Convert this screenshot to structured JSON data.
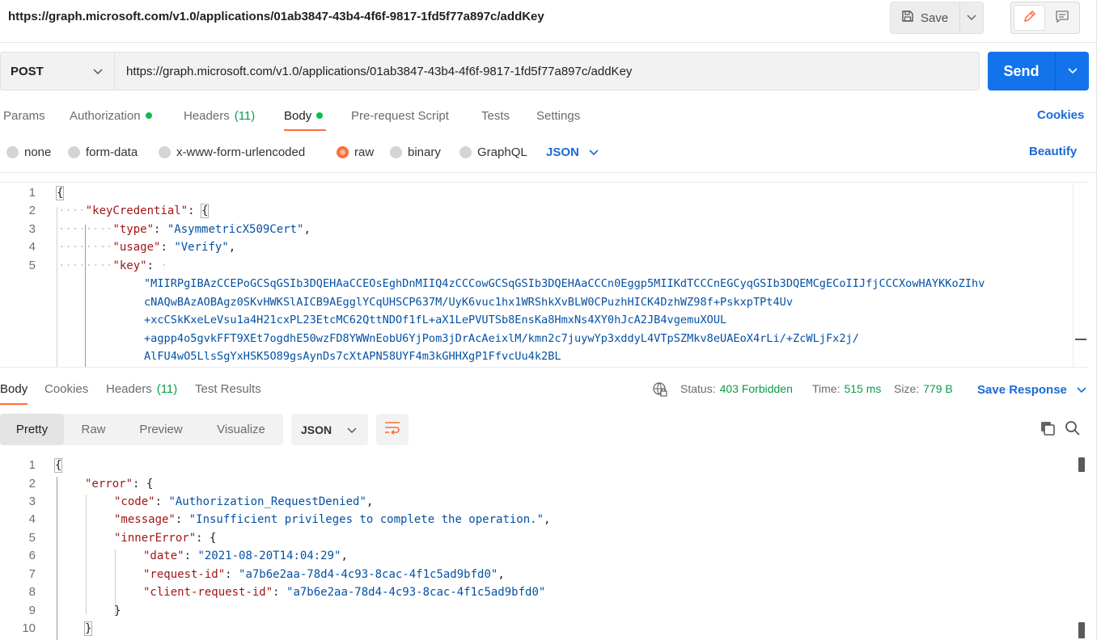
{
  "header": {
    "title_url": "https://graph.microsoft.com/v1.0/applications/01ab3847-43b4-4f6f-9817-1fd5f77a897c/addKey",
    "save_label": "Save"
  },
  "request": {
    "method": "POST",
    "url": "https://graph.microsoft.com/v1.0/applications/01ab3847-43b4-4f6f-9817-1fd5f77a897c/addKey",
    "send_label": "Send"
  },
  "request_tabs": {
    "params": "Params",
    "authorization": "Authorization",
    "headers": "Headers",
    "headers_count": "(11)",
    "body": "Body",
    "prerequest": "Pre-request Script",
    "tests": "Tests",
    "settings": "Settings",
    "cookies": "Cookies"
  },
  "body_options": {
    "none": "none",
    "form_data": "form-data",
    "urlencoded": "x-www-form-urlencoded",
    "raw": "raw",
    "binary": "binary",
    "graphql": "GraphQL",
    "format": "JSON",
    "beautify": "Beautify"
  },
  "request_body": {
    "line_numbers": [
      "1",
      "2",
      "3",
      "4",
      "5"
    ],
    "open_brace": "{",
    "key_credential_key": "\"keyCredential\"",
    "type_key": "\"type\"",
    "type_value": "\"AsymmetricX509Cert\"",
    "usage_key": "\"usage\"",
    "usage_value": "\"Verify\"",
    "key_key": "\"key\"",
    "key_value_lines": [
      "\"MIIRPgIBAzCCEPoGCSqGSIb3DQEHAaCCEOsEghDnMIIQ4zCCCowGCSqGSIb3DQEHAaCCCn0Eggp5MIIKdTCCCnEGCyqGSIb3DQEMCgECoIIJfjCCCXowHAYKKoZIhv",
      "cNAQwBAzAOBAgz0SKvHWKSlAICB9AEgglYCqUHSCP637M/UyK6vuc1hx1WRShkXvBLW0CPuzhHICK4DzhWZ98f+PskxpTPt4Uv",
      "+xcCSkKxeLeVsu1a4H21cxPL23EtcMC62QttNDOf1fL+aX1LePVUTSb8EnsKa8HmxNs4XY0hJcA2JB4vgemuXOUL",
      "+agpp4o5gvkFFT9XEt7ogdhE50wzFD8YWWnEobU6YjPom3jDrAcAeixlM/kmn2c7juywYp3xddyL4VTpSZMkv8eUAEoX4rLi/+ZcWLjFx2j/",
      "AlFU4wO5LlsSgYxHSK5O89gsAynDs7cXtAPN58UYF4m3kGHHXgP1FfvcUu4k2BL"
    ]
  },
  "response_tabs": {
    "body": "Body",
    "cookies": "Cookies",
    "headers": "Headers",
    "headers_count": "(11)",
    "test_results": "Test Results"
  },
  "response_status": {
    "status_label": "Status:",
    "status_value": "403 Forbidden",
    "time_label": "Time:",
    "time_value": "515 ms",
    "size_label": "Size:",
    "size_value": "779 B",
    "save_response": "Save Response"
  },
  "response_view": {
    "pretty": "Pretty",
    "raw": "Raw",
    "preview": "Preview",
    "visualize": "Visualize",
    "format": "JSON"
  },
  "response_body": {
    "line_numbers": [
      "1",
      "2",
      "3",
      "4",
      "5",
      "6",
      "7",
      "8",
      "9",
      "10"
    ],
    "open_brace": "{",
    "error_key": "\"error\"",
    "code_key": "\"code\"",
    "code_value": "\"Authorization_RequestDenied\"",
    "message_key": "\"message\"",
    "message_value": "\"Insufficient privileges to complete the operation.\"",
    "inner_error_key": "\"innerError\"",
    "date_key": "\"date\"",
    "date_value": "\"2021-08-20T14:04:29\"",
    "request_id_key": "\"request-id\"",
    "request_id_value": "\"a7b6e2aa-78d4-4c93-8cac-4f1c5ad9bfd0\"",
    "client_request_id_key": "\"client-request-id\"",
    "client_request_id_value": "\"a7b6e2aa-78d4-4c93-8cac-4f1c5ad9bfd0\"",
    "close_brace": "}"
  },
  "colors": {
    "accent": "#ff6c37",
    "primary": "#1273eb",
    "link": "#1a6ad8",
    "success": "#0e9b4a"
  }
}
